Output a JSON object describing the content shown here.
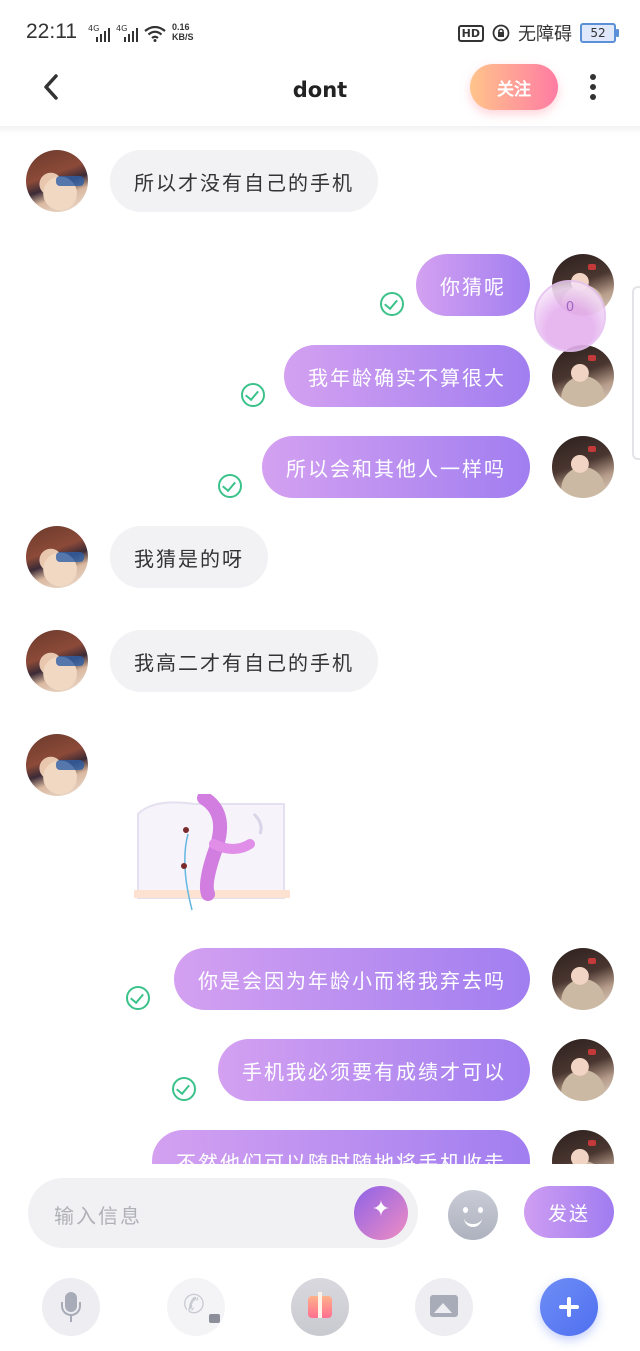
{
  "status_bar": {
    "time": "22:11",
    "network_1": "4G",
    "network_2": "4G",
    "speed_value": "0.16",
    "speed_unit": "KB/S",
    "hd_label": "HD",
    "accessibility": "无障碍",
    "battery": "52"
  },
  "header": {
    "title": "dont",
    "follow_label": "关注"
  },
  "floating_badge": "0",
  "messages": [
    {
      "side": "left",
      "text": "所以才没有自己的手机"
    },
    {
      "side": "right",
      "text": "你猜呢",
      "read": true
    },
    {
      "side": "right",
      "text": "我年龄确实不算很大",
      "read": true
    },
    {
      "side": "right",
      "text": "所以会和其他人一样吗",
      "read": true
    },
    {
      "side": "left",
      "text": "我猜是的呀"
    },
    {
      "side": "left",
      "text": "我高二才有自己的手机"
    },
    {
      "side": "left",
      "type": "sticker"
    },
    {
      "side": "right",
      "text": "你是会因为年龄小而将我弃去吗",
      "read": true
    },
    {
      "side": "right",
      "text": "手机我必须要有成绩才可以",
      "read": true
    },
    {
      "side": "right",
      "text": "不然他们可以随时随地将手机收走",
      "read": true
    }
  ],
  "input": {
    "placeholder": "输入信息",
    "send_label": "发送"
  },
  "toolbar": [
    "voice-icon",
    "call-icon",
    "gift-icon",
    "image-icon",
    "plus-icon"
  ],
  "colors": {
    "accent_purple": "#a17ef0",
    "follow_gradient_start": "#ffc48b",
    "follow_gradient_end": "#ff7ba3",
    "read_check": "#3ac28a"
  }
}
